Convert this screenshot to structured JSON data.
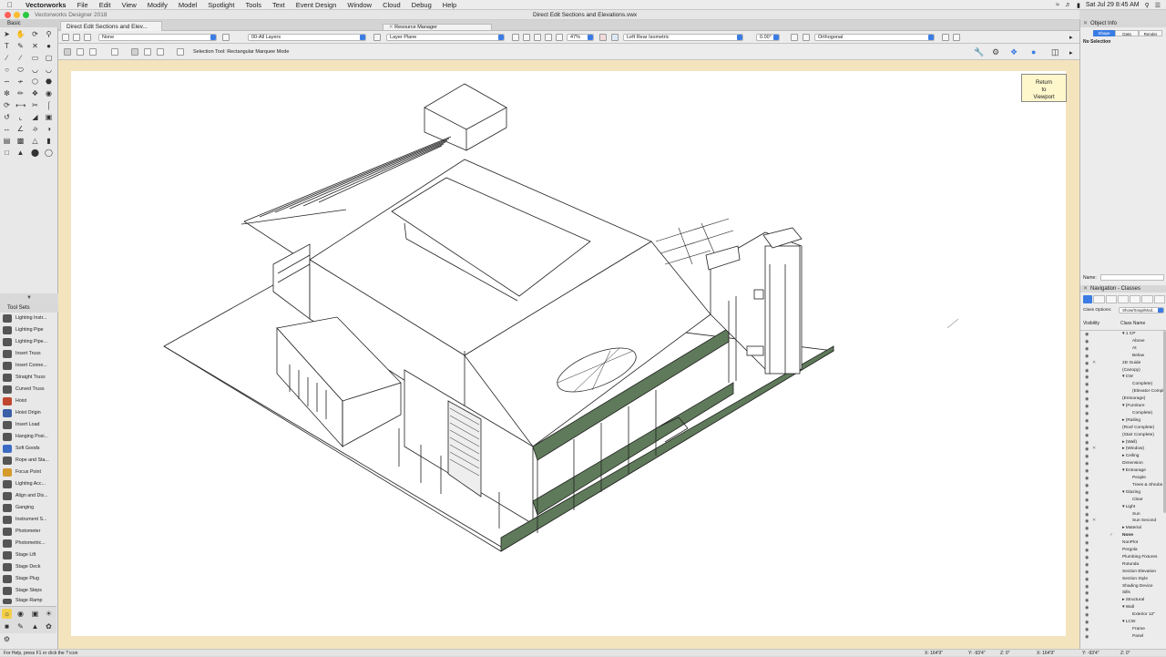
{
  "menubar": {
    "items": [
      "Vectorworks",
      "File",
      "Edit",
      "View",
      "Modify",
      "Model",
      "Spotlight",
      "Tools",
      "Text",
      "Event Design",
      "Window",
      "Cloud",
      "Debug",
      "Help"
    ],
    "clock": "Sat Jul 29  8:45 AM"
  },
  "window": {
    "app_title": "Vectorworks Designer 2018",
    "doc_title": "Direct Edit Sections and Elevations.vwx"
  },
  "tabs": {
    "doc_tab": "Direct Edit Sections and Elev...",
    "resource_tab": "Resource Manager"
  },
  "viewbar": {
    "class_value": "None",
    "layer_value": "00-All Layers",
    "plane_value": "Layer Plane",
    "zoom_value": "47%",
    "view_value": "Left Rear Isometric",
    "rotation_value": "0.00°",
    "projection_value": "Orthogonal"
  },
  "modebar": {
    "hint": "Selection Tool: Rectangular Marquee Mode"
  },
  "palette": {
    "basic_title": "Basic",
    "toolsets_title": "Tool Sets",
    "tools": [
      "Lighting Instr...",
      "Lighting Pipe",
      "Lighting Pipe...",
      "Insert Truss",
      "Insert Conne...",
      "Straight Truss",
      "Curved Truss",
      "Hoist",
      "Hoist Origin",
      "Insert Load",
      "Hanging Posi...",
      "Soft Goods",
      "Rope and Sta...",
      "Focus Point",
      "Lighting Acc...",
      "Align and Dis...",
      "Ganging",
      "Instrument S...",
      "Photometer",
      "Photometric...",
      "Stage Lift",
      "Stage Deck",
      "Stage Plug",
      "Stage Steps",
      "Stage Ramp"
    ]
  },
  "canvas": {
    "return_button": "Return\nto\nViewport"
  },
  "object_info": {
    "title": "Object Info",
    "tabs": [
      "Shape",
      "Data",
      "Render"
    ],
    "selection": "No Selection",
    "name_label": "Name:"
  },
  "navigation": {
    "title": "Navigation - Classes",
    "class_options_label": "Class Options:",
    "class_options_value": "Show/Snap/Mod...",
    "col_visibility": "Visibility",
    "col_class_name": "Class Name",
    "classes": [
      {
        "name": "▾ 1 CP",
        "indent": 1
      },
      {
        "name": "Above",
        "indent": 2
      },
      {
        "name": "At",
        "indent": 2
      },
      {
        "name": "Below",
        "indent": 2
      },
      {
        "name": "2D Guide",
        "indent": 1
      },
      {
        "name": "(Canopy)",
        "indent": 1
      },
      {
        "name": "▾ CW",
        "indent": 1
      },
      {
        "name": "Complete)",
        "indent": 2
      },
      {
        "name": "(Elevator Complex)",
        "indent": 2
      },
      {
        "name": "(Entourage)",
        "indent": 1
      },
      {
        "name": "▾ (Furniture",
        "indent": 1
      },
      {
        "name": "Complete)",
        "indent": 2
      },
      {
        "name": "▸ (Railing",
        "indent": 1
      },
      {
        "name": "(Roof Complete)",
        "indent": 1
      },
      {
        "name": "(Stair Complete)",
        "indent": 1
      },
      {
        "name": "▸ (Wall)",
        "indent": 1
      },
      {
        "name": "▸ (Window)",
        "indent": 1
      },
      {
        "name": "▸ Ceiling",
        "indent": 1
      },
      {
        "name": "Dimension",
        "indent": 1
      },
      {
        "name": "▾ Entourage",
        "indent": 1
      },
      {
        "name": "People",
        "indent": 2
      },
      {
        "name": "Trees & Shrubs",
        "indent": 2
      },
      {
        "name": "▾ Glazing",
        "indent": 1
      },
      {
        "name": "Clear",
        "indent": 2
      },
      {
        "name": "▾ Light",
        "indent": 1
      },
      {
        "name": "Sun",
        "indent": 2
      },
      {
        "name": "Sun Second",
        "indent": 2
      },
      {
        "name": "▸ Material",
        "indent": 1
      },
      {
        "name": "None",
        "indent": 1
      },
      {
        "name": "NonPlot",
        "indent": 1
      },
      {
        "name": "Pergola",
        "indent": 1
      },
      {
        "name": "Plumbing Fixtures",
        "indent": 1
      },
      {
        "name": "Rotunda",
        "indent": 1
      },
      {
        "name": "Section Elevation",
        "indent": 1
      },
      {
        "name": "Section Style",
        "indent": 1
      },
      {
        "name": "Shading Device",
        "indent": 1
      },
      {
        "name": "Sills",
        "indent": 1
      },
      {
        "name": "▸ Structural",
        "indent": 1
      },
      {
        "name": "▾ Wall",
        "indent": 1
      },
      {
        "name": "Exterior 12\"",
        "indent": 2
      },
      {
        "name": "▾ LCW",
        "indent": 1
      },
      {
        "name": "Frame",
        "indent": 2
      },
      {
        "name": "Panel",
        "indent": 2
      }
    ]
  },
  "statusbar": {
    "help": "For Help, press F1 or click the ? icon",
    "x": "X: 164'9\"",
    "y": "Y: -93'4\"",
    "z": "Z: 0\"",
    "x2": "X: 164'9\"",
    "y2": "Y: -93'4\"",
    "z2": "Z: 0\""
  },
  "colors": {
    "canvas_border": "#f3e4bd",
    "accent": "#3b7ce4",
    "glazing_green": "#5f7a5a"
  }
}
